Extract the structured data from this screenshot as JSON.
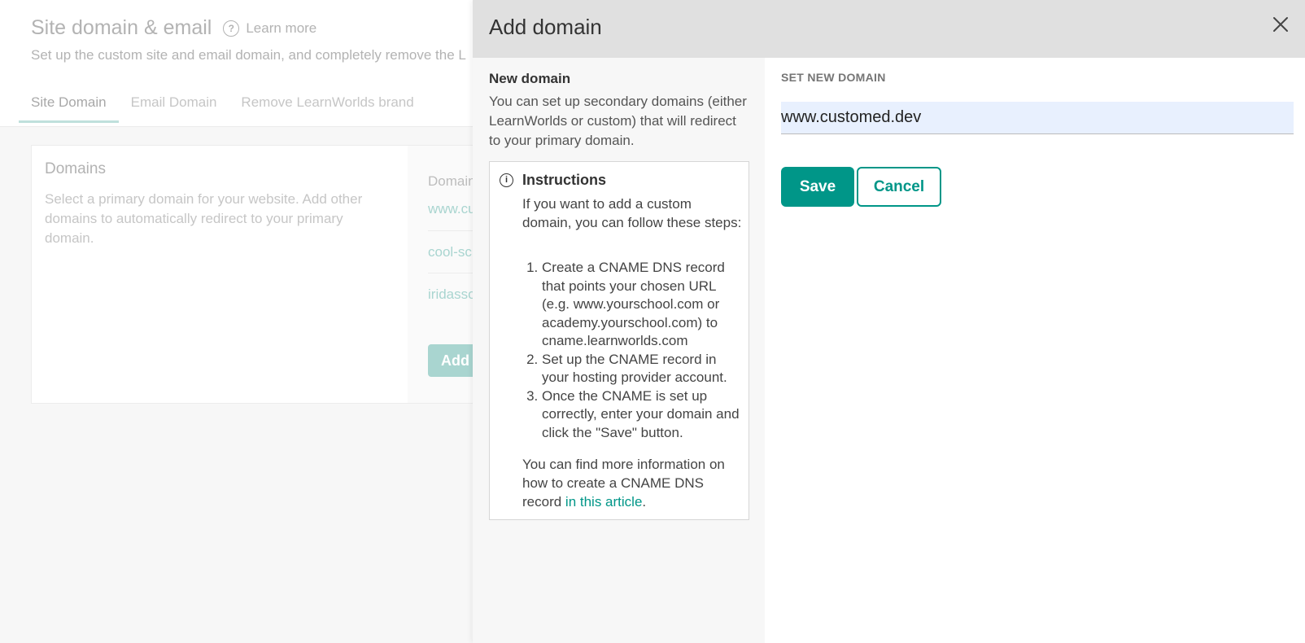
{
  "background": {
    "title": "Site domain & email",
    "learn_more": "Learn more",
    "subtitle": "Set up the custom site and email domain, and completely remove the L",
    "tabs": [
      {
        "label": "Site Domain",
        "active": true
      },
      {
        "label": "Email Domain",
        "active": false
      },
      {
        "label": "Remove LearnWorlds brand",
        "active": false
      }
    ],
    "card": {
      "title": "Domains",
      "description": "Select a primary domain for your website. Add other domains to automatically redirect to your primary domain.",
      "column_header": "Domain",
      "domains": [
        "www.cu",
        "cool-sc",
        "iridasso"
      ],
      "add_button": "Add d"
    }
  },
  "panel": {
    "title": "Add domain",
    "close_icon": "close-icon",
    "left": {
      "heading": "New domain",
      "description": "You can set up secondary domains (either LearnWorlds or custom) that will redirect to your primary domain.",
      "instructions": {
        "icon": "info-icon",
        "title": "Instructions",
        "intro": "If you want to add a custom domain, you can follow these steps:",
        "steps": [
          "Create a CNAME DNS record that points your chosen URL (e.g. www.yourschool.com or academy.yourschool.com) to cname.learnworlds.com",
          "Set up the CNAME record in your hosting provider account.",
          "Once the CNAME is set up correctly, enter your domain and click the \"Save\" button."
        ],
        "more_prefix": "You can find more information on how to create a CNAME DNS record ",
        "more_link": "in this article",
        "more_suffix": "."
      }
    },
    "right": {
      "label": "SET NEW DOMAIN",
      "domain_value": "www.customed.dev",
      "save_label": "Save",
      "cancel_label": "Cancel"
    }
  },
  "colors": {
    "accent": "#009688",
    "header_bg": "#e0e0e0",
    "input_bg": "#e8f0fe"
  }
}
